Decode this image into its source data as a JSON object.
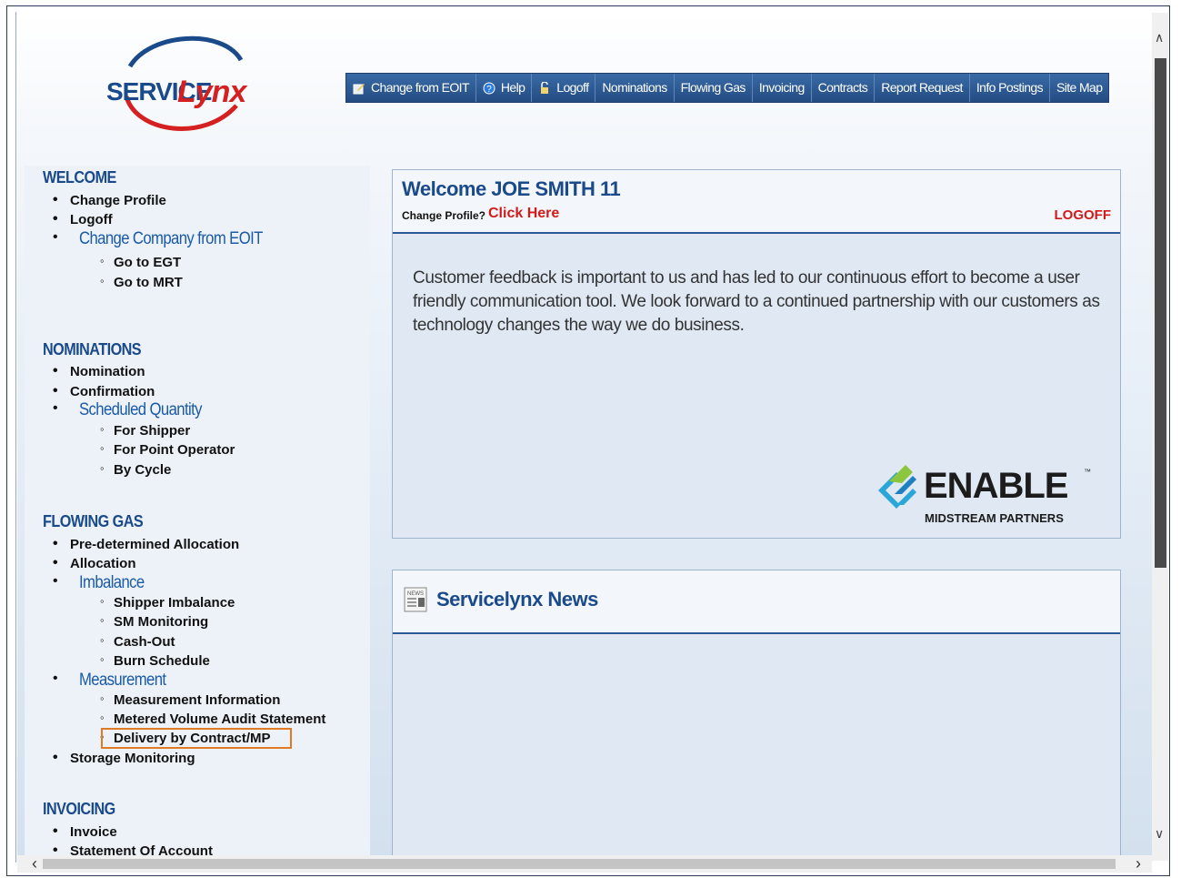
{
  "header": {
    "logo_text_service": "SERVICE",
    "logo_text_lynx": "Lynx"
  },
  "topnav": [
    {
      "label": "Change from EOIT",
      "icon": "edit-icon"
    },
    {
      "label": "Help",
      "icon": "help-icon"
    },
    {
      "label": "Logoff",
      "icon": "lock-icon"
    },
    {
      "label": "Nominations"
    },
    {
      "label": "Flowing Gas"
    },
    {
      "label": "Invoicing"
    },
    {
      "label": "Contracts"
    },
    {
      "label": "Report Request"
    },
    {
      "label": "Info Postings"
    },
    {
      "label": "Site Map"
    }
  ],
  "sidebar": {
    "welcome": {
      "title": "WELCOME",
      "items": [
        "Change Profile",
        "Logoff"
      ],
      "group": "Change Company from EOIT",
      "sub": [
        "Go to EGT",
        "Go to MRT"
      ]
    },
    "nominations": {
      "title": "NOMINATIONS",
      "items": [
        "Nomination",
        "Confirmation"
      ],
      "group": "Scheduled Quantity",
      "sub": [
        "For Shipper",
        "For Point Operator",
        "By Cycle"
      ]
    },
    "flowing_gas": {
      "title": "FLOWING GAS",
      "items": [
        "Pre-determined Allocation",
        "Allocation"
      ],
      "group1": "Imbalance",
      "sub1": [
        "Shipper Imbalance",
        "SM Monitoring",
        "Cash-Out",
        "Burn Schedule"
      ],
      "group2": "Measurement",
      "sub2": [
        "Measurement Information",
        "Metered Volume Audit Statement",
        "Delivery by Contract/MP"
      ],
      "last": "Storage Monitoring"
    },
    "invoicing": {
      "title": "INVOICING",
      "items": [
        "Invoice",
        "Statement Of Account"
      ]
    }
  },
  "welcome_panel": {
    "title": "Welcome JOE SMITH 11",
    "change_profile_label": "Change Profile?",
    "click_here": "Click Here",
    "logoff": "LOGOFF",
    "body": "Customer feedback is important to us and has led to our continuous effort to become a user friendly communication tool.   We look forward to a continued partnership with our customers as technology changes the way we do business.",
    "enable_brand": "ENABLE",
    "enable_tm": "™",
    "enable_sub": "MIDSTREAM PARTNERS"
  },
  "news_panel": {
    "title": "Servicelynx News",
    "icon_label": "NEWS"
  },
  "colors": {
    "brand_blue": "#1a4a8a",
    "nav_blue": "#2d5a94",
    "link_red": "#d11a1a",
    "highlight_orange": "#e07a24"
  }
}
